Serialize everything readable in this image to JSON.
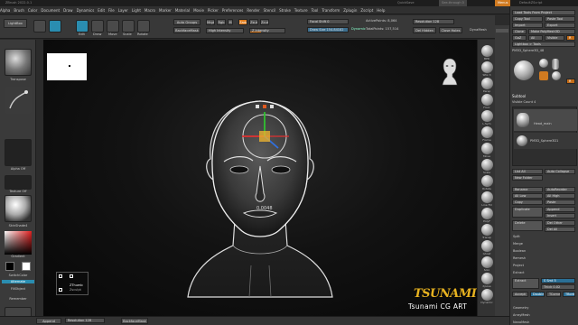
{
  "title_bar": {
    "text": "ZBrush 2022.0.1"
  },
  "menu": [
    "Alpha",
    "Brush",
    "Color",
    "Document",
    "Draw",
    "Dynamics",
    "Edit",
    "File",
    "Layer",
    "Light",
    "Macro",
    "Marker",
    "Material",
    "Movie",
    "Picker",
    "Preferences",
    "Render",
    "Stencil",
    "Stroke",
    "Texture",
    "Tool",
    "Transform",
    "Zplugin",
    "Zscript",
    "Help"
  ],
  "top_right": {
    "quicksave": "QuickSave",
    "seethrough": "See-through 0",
    "menus": "Menus",
    "defaultscript": "DefaultZScript"
  },
  "toolbar": {
    "lightbox": "LightBox",
    "projection_master": "Projection Master",
    "quick_sketch": "Quick Sketch",
    "edit": "Edit",
    "draw": "Draw",
    "move": "Move",
    "scale": "Scale",
    "rotate": "Rotate",
    "gizmo": "Gizmo",
    "auto_groups": "Auto Groups",
    "backface_mask": "BackfaceMask",
    "mrgb": "Mrgb",
    "rgb": "Rgb",
    "m": "M",
    "zadd": "Zadd",
    "zsub": "Zsub",
    "zcut": "Zcut",
    "focal_shift": "Focal Shift 0",
    "draw_size": "Draw Size 154.84182",
    "dynamic": "Dynamic",
    "active_points": "ActivePoints: 8,064",
    "total_points": "TotalPoints: 157,514",
    "resolution": "Resolution 128",
    "del_hidden": "Del Hidden",
    "close_holes": "Close Holes",
    "high_intensity": "High Intensity",
    "z_intensity": "Z Intensity",
    "dynamesh": "DynaMesh"
  },
  "left": {
    "transpose": "Transpose",
    "alpha_off": "Alpha Off",
    "texture_off": "Texture Off",
    "matcap": "SkinShade4",
    "gradient": "Gradient",
    "switch_color": "SwitchColor",
    "alternate": "Alternate",
    "fill_object": "FillObject",
    "remember": "Remember",
    "xpose": "XPose",
    "brush_label": "Standard"
  },
  "viewport": {
    "xyz_value": "0.0048",
    "tsunami_title": "TSUNAMI",
    "tsunami_sub": "Tsunami CG ART",
    "mini_frame": "ZThumb",
    "mini_value": "Zsculpt"
  },
  "right_shelf": {
    "items": [
      "BPR",
      "SPix 3",
      "Persp",
      "Floor",
      "L.Sym",
      "Frame",
      "Move",
      "Scale",
      "Rotate",
      "Line Fill",
      "PolyF",
      "Transp",
      "Ghost",
      "Solo",
      "Xpose",
      "Dynamic"
    ]
  },
  "tool_panel": {
    "load": "Load Tools From Project",
    "copy_tool": "Copy Tool",
    "paste_tool": "Paste Tool",
    "import": "Import",
    "export": "Export",
    "clone": "Clone",
    "make_polymesh": "Make PolyMesh3D",
    "goz": "GoZ",
    "all": "All",
    "visible": "Visible",
    "r": "R",
    "lightbox_tools": "Lightbox > Tools",
    "current_tool": "PM3D_Sphere3D_48",
    "tool_thumbs": [
      "PM3D_Sphere3D",
      "Cylinder PolyMesh3D",
      "SimpleBrush",
      "PM3D_Sphere3D_1"
    ],
    "r2": "R",
    "subtool_title": "Subtool",
    "visible_count": "Visible Count 4",
    "subtools": [
      "Head_main",
      "PM3D_Sphere3D1"
    ],
    "list_all": "List All",
    "auto_collapse": "Auto Collapse",
    "new_folder": "New Folder",
    "rename": "Rename",
    "auto_reorder": "AutoReorder",
    "all_low": "All Low",
    "all_high": "All High",
    "copy": "Copy",
    "paste": "Paste",
    "duplicate": "Duplicate",
    "append": "Append",
    "insert": "Insert",
    "delete": "Delete",
    "del_other": "Del Other",
    "del_all": "Del All",
    "split": "Split",
    "merge": "Merge",
    "boolean": "Boolean",
    "remesh": "Remesh",
    "project": "Project",
    "extract": "Extract",
    "extract_btn": "Extract",
    "s_smt": "S Smt 5",
    "thick": "Thick 0.02",
    "accept": "Accept",
    "double": "Double",
    "tcorner": "TCorner",
    "tborder": "TBorder",
    "geometry": "Geometry",
    "array_mesh": "ArrayMesh",
    "nano_mesh": "NanoMesh"
  },
  "bottom": {
    "append": "Append",
    "resolution": "Resolution 128",
    "backface": "BackfaceMask"
  }
}
